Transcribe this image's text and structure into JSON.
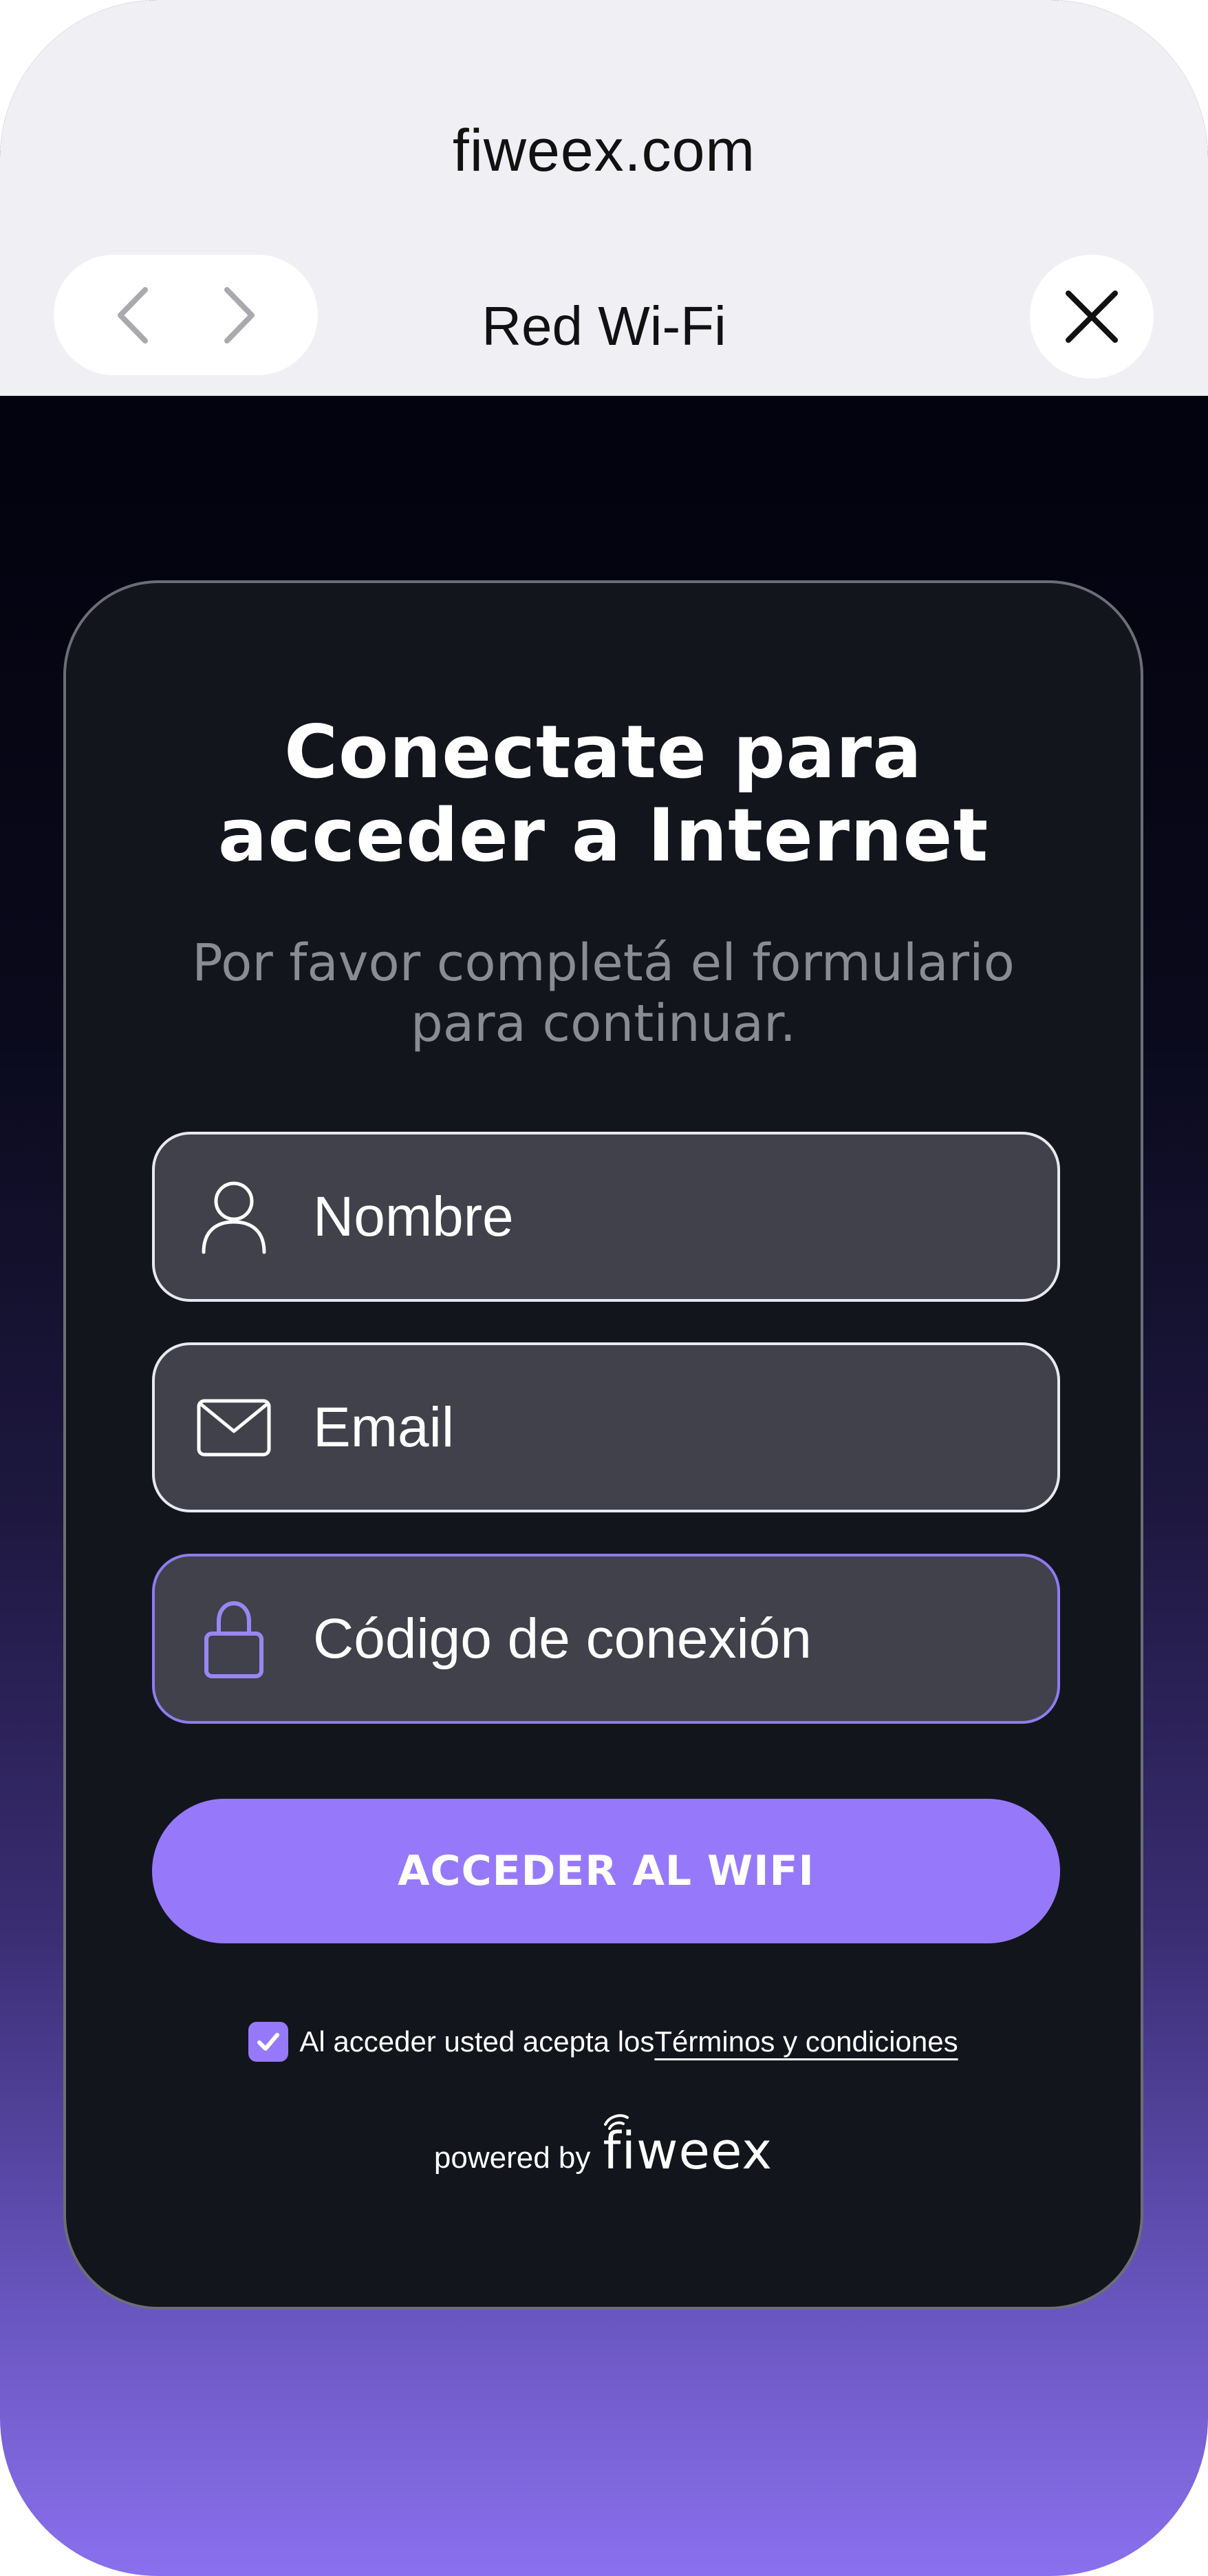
{
  "browser": {
    "url": "fiweex.com",
    "tab_title": "Red Wi-Fi",
    "back_icon": "chevron-left-icon",
    "forward_icon": "chevron-right-icon",
    "close_icon": "close-icon"
  },
  "card": {
    "heading_line1": "Conectate para",
    "heading_line2": "acceder a Internet",
    "subheading_line1": "Por favor completá el formulario",
    "subheading_line2": "para continuar."
  },
  "form": {
    "name_placeholder": "Nombre",
    "name_icon": "user-icon",
    "email_placeholder": "Email",
    "email_icon": "mail-icon",
    "code_placeholder": "Código de conexión",
    "code_icon": "lock-icon",
    "submit_label": "ACCEDER AL WIFI",
    "terms_text": "Al acceder usted acepta los",
    "terms_link": "Términos y condiciones",
    "terms_checked": true
  },
  "footer": {
    "powered_by": "powered by",
    "brand": "fiweex"
  },
  "colors": {
    "accent": "#9679fb",
    "card_bg": "#13151c",
    "field_bg": "#40414a",
    "browser_bar": "#f0eff4"
  }
}
